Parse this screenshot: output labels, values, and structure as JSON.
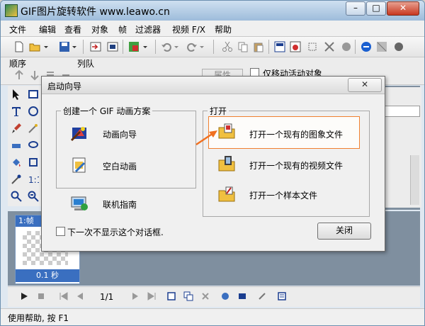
{
  "window": {
    "title": "GIF图片旋转软件 www.leawo.cn",
    "minimize": "–",
    "maximize": "□",
    "close": "✕"
  },
  "menu": [
    "文件",
    "编辑",
    "查看",
    "对象",
    "帧",
    "过滤器",
    "视频 F/X",
    "帮助"
  ],
  "subbar": {
    "order_label": "顺序",
    "queue_label": "列队",
    "attributes_button": "属性",
    "move_only_label": "仅移动活动对象"
  },
  "frame": {
    "header": "1:帧",
    "duration": "0.1 秒"
  },
  "playback": {
    "counter": "1/1"
  },
  "status": {
    "text": "使用帮助, 按 F1"
  },
  "dialog": {
    "title": "启动向导",
    "close_glyph": "✕",
    "create_group_title": "创建一个 GIF 动画方案",
    "create_items": [
      "动画向导",
      "空白动画"
    ],
    "online_guide": "联机指南",
    "open_group_title": "打开",
    "open_items": [
      "打开一个现有的图象文件",
      "打开一个现有的视频文件",
      "打开一个样本文件"
    ],
    "dont_show_label": "下一次不显示这个对话框.",
    "close_button": "关闭"
  },
  "colors": {
    "highlight_border": "#f08030",
    "arrow": "#f07020",
    "selected_frame": "#3a6fc0"
  }
}
